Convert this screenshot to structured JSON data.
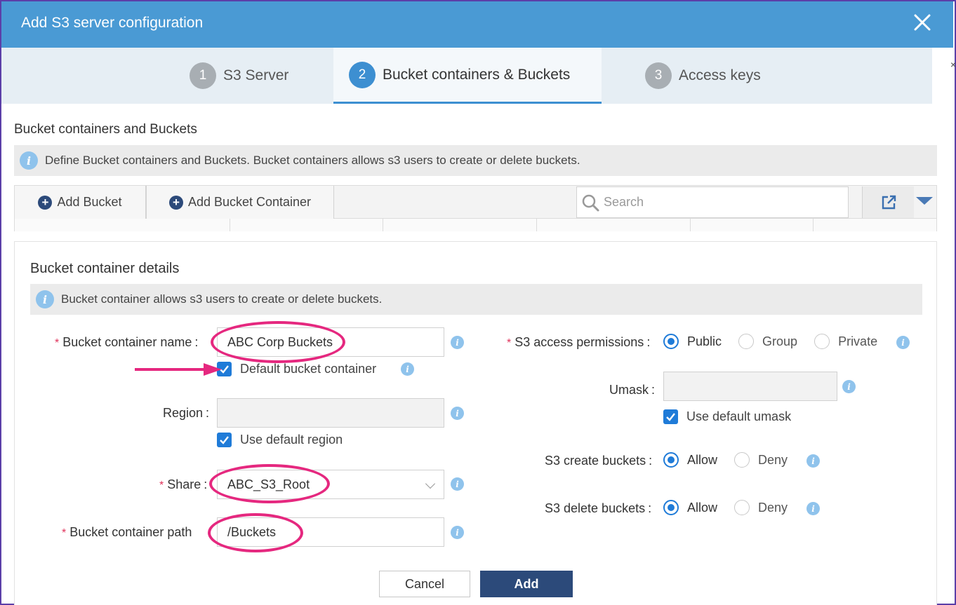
{
  "window": {
    "title": "Add S3 server configuration",
    "close_icon": "close-icon",
    "edge_char": "×"
  },
  "steps": [
    {
      "num": "1",
      "label": "S3 Server",
      "active": false
    },
    {
      "num": "2",
      "label": "Bucket containers & Buckets",
      "active": true
    },
    {
      "num": "3",
      "label": "Access keys",
      "active": false
    }
  ],
  "section": {
    "title": "Bucket containers and Buckets",
    "info": "Define Bucket containers and Buckets. Bucket containers allows s3 users to create or delete buckets."
  },
  "toolbar": {
    "add_bucket": "Add Bucket",
    "add_bucket_container": "Add Bucket Container",
    "search_placeholder": "Search"
  },
  "details": {
    "title": "Bucket container details",
    "info": "Bucket container allows s3 users to create or delete buckets.",
    "name_label": "Bucket container name",
    "name_value": "ABC Corp Buckets",
    "default_container_label": "Default bucket container",
    "default_container_checked": true,
    "region_label": "Region",
    "region_value": "",
    "use_default_region_label": "Use default region",
    "use_default_region_checked": true,
    "share_label": "Share",
    "share_value": "ABC_S3_Root",
    "path_label": "Bucket container path",
    "path_value": "/Buckets",
    "access_label": "S3 access permissions",
    "access_options": [
      "Public",
      "Group",
      "Private"
    ],
    "access_selected": "Public",
    "umask_label": "Umask",
    "umask_value": "",
    "use_default_umask_label": "Use default umask",
    "use_default_umask_checked": true,
    "create_label": "S3 create buckets",
    "create_options": [
      "Allow",
      "Deny"
    ],
    "create_selected": "Allow",
    "delete_label": "S3 delete buckets",
    "delete_options": [
      "Allow",
      "Deny"
    ],
    "delete_selected": "Allow",
    "colon": ":",
    "required_mark": "*"
  },
  "buttons": {
    "cancel": "Cancel",
    "add": "Add"
  },
  "colors": {
    "header": "#4a9ad4",
    "accent": "#1f7bd8",
    "primary_button": "#2c4a7a",
    "highlight": "#e5287f"
  }
}
